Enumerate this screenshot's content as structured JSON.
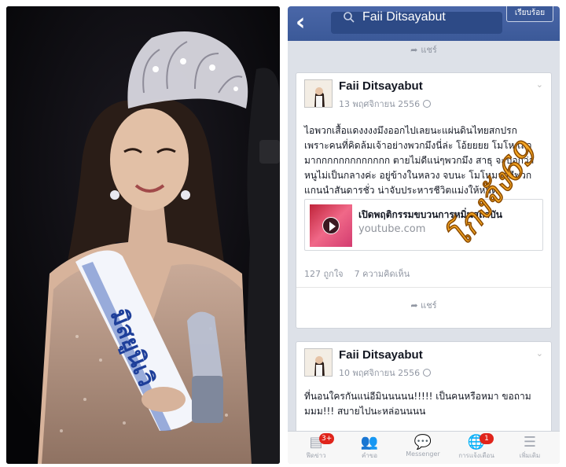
{
  "photo": {
    "sash_text": "มิสยูนิเวิ"
  },
  "header": {
    "search_query": "Faii Ditsayabut",
    "done_label": "เรียบร้อย",
    "back_icon": "chevron-left-icon",
    "search_icon": "search-icon"
  },
  "share_label": "แชร์",
  "posts": [
    {
      "author": "Faii Ditsayabut",
      "date": "13 พฤศจิกายน 2556",
      "lines": [
        "ไอพวกเสื้อแดงงงงมึงออกไปเลยนะแผ่นดินไทยสกปรก",
        "เพราะคนที่คิดล้มเจ้าอย่างพวกมึงนี่ล่ะ โอ้ยยยย โมโห เลว",
        "มากกกกกกกกกกกกก ตายไม่ดีแน่ๆพวกมึง สาธุ จะบอกว่า",
        "หนูไม่เป็นกลางค่ะ อยู่ข้างในหลวง จบนะ โมโหมากอีพวก",
        "แกนนำสันดารชั่ว น่าจับประหารชีวิตแม่งให้หมด"
      ],
      "link_title": "เปิดพฤติกรรมขบวนการหมิ่นสถาบัน",
      "link_domain": "youtube.com",
      "likes": "127 ถูกใจ",
      "comments": "7 ความคิดเห็น"
    },
    {
      "author": "Faii Ditsayabut",
      "date": "10 พฤศจิกายน 2556",
      "lines": [
        "ที่นอนใครกันแน่อีมินนนนน!!!!! เป็นคนหรือหมา ขอถาม",
        "มมม!!! สบายไปนะหล่อนนนน"
      ]
    }
  ],
  "watermark": "โกงจัง69",
  "bottom_tabs": [
    {
      "icon": "news-feed-icon",
      "label": "ฟีดข่าว",
      "badge": "3+"
    },
    {
      "icon": "friends-icon",
      "label": "คำขอ",
      "badge": ""
    },
    {
      "icon": "messenger-icon",
      "label": "Messenger",
      "badge": ""
    },
    {
      "icon": "globe-icon",
      "label": "การแจ้งเตือน",
      "badge": "1"
    },
    {
      "icon": "menu-icon",
      "label": "เพิ่มเติม",
      "badge": ""
    }
  ],
  "colors": {
    "facebook_blue": "#3b5998",
    "badge_red": "#e0241b",
    "watermark_orange": "#f5a623"
  }
}
